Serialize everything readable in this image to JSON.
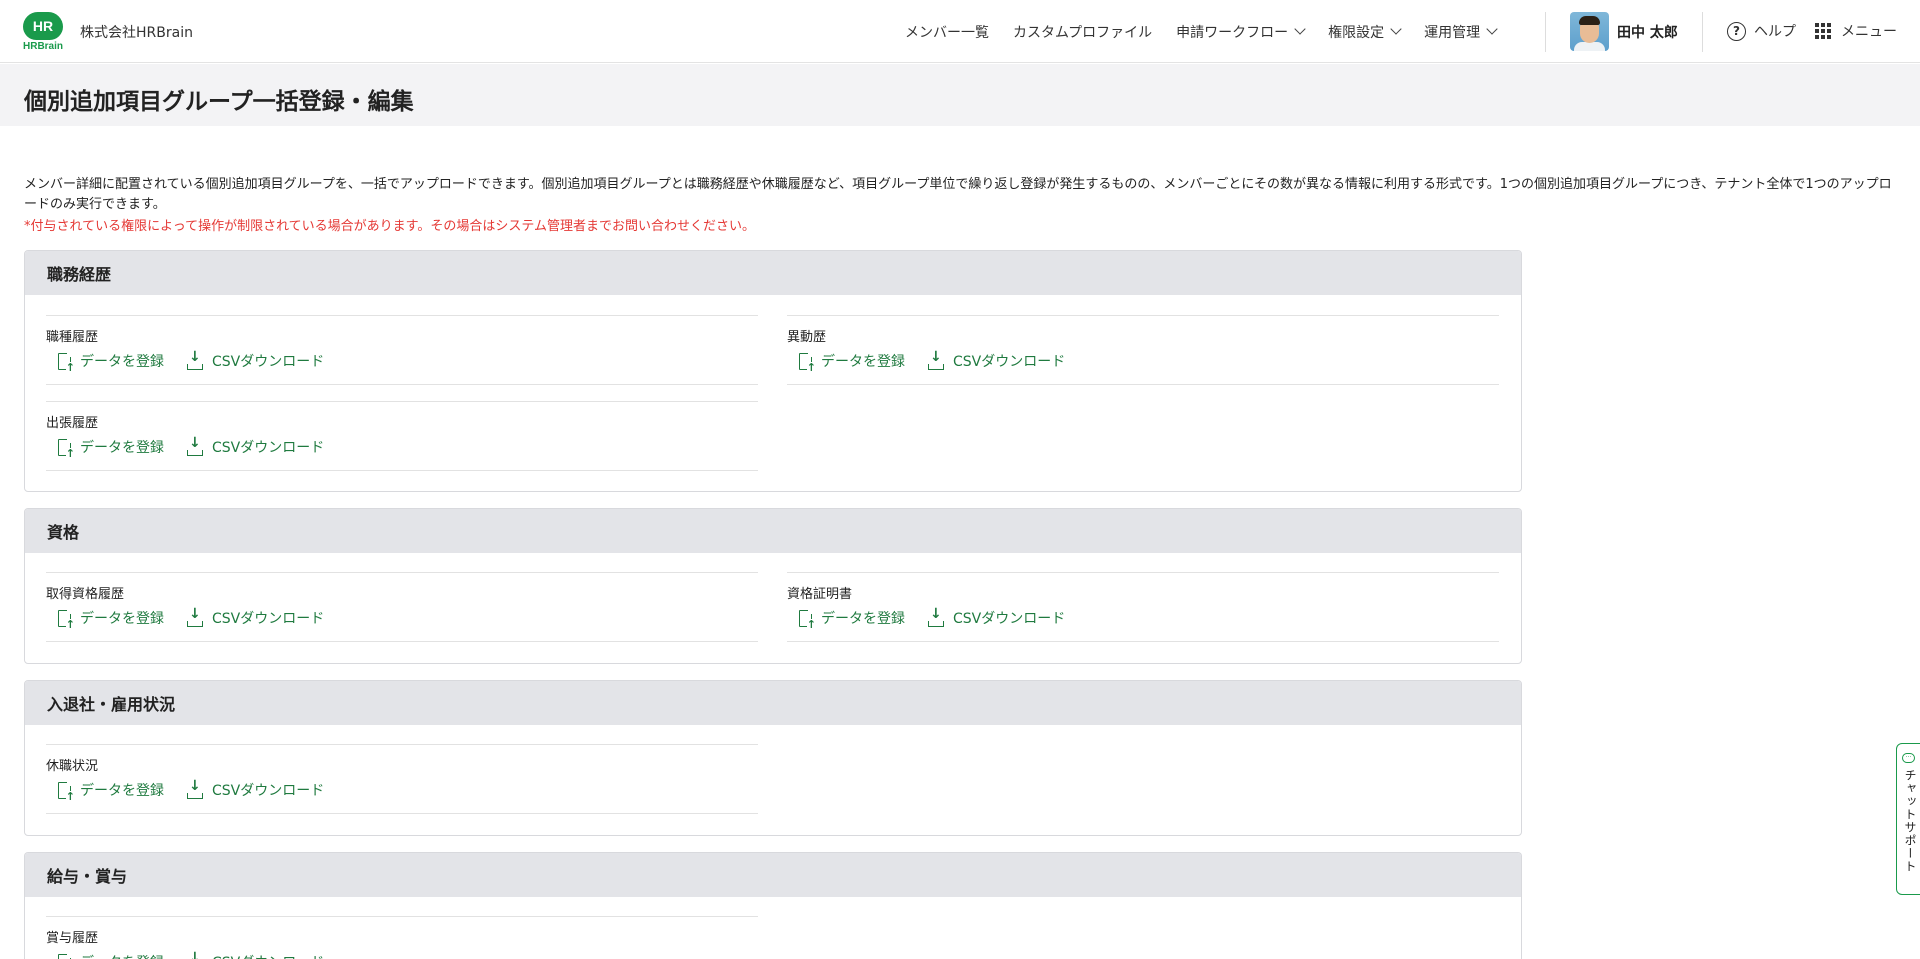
{
  "header": {
    "logo_badge": "HR",
    "logo_text": "HRBrain",
    "company": "株式会社HRBrain",
    "nav": [
      {
        "label": "メンバー一覧"
      },
      {
        "label": "カスタムプロファイル"
      },
      {
        "label": "申請ワークフロー"
      },
      {
        "label": "権限設定"
      },
      {
        "label": "運用管理"
      }
    ],
    "user_name": "田中 太郎",
    "help_label": "ヘルプ",
    "menu_label": "メニュー"
  },
  "page": {
    "title": "個別追加項目グループ一括登録・編集",
    "description": "メンバー詳細に配置されている個別追加項目グループを、一括でアップロードできます。個別追加項目グループとは職務経歴や休職履歴など、項目グループ単位で繰り返し登録が発生するものの、メンバーごとにその数が異なる情報に利用する形式です。1つの個別追加項目グループにつき、テナント全体で1つのアップロードのみ実行できます。",
    "notice": "*付与されている権限によって操作が制限されている場合があります。その場合はシステム管理者までお問い合わせください。"
  },
  "actions": {
    "register": "データを登録",
    "download": "CSVダウンロード"
  },
  "sections": [
    {
      "title": "職務経歴",
      "items": [
        "職種履歴",
        "異動歴",
        "出張履歴"
      ]
    },
    {
      "title": "資格",
      "items": [
        "取得資格履歴",
        "資格証明書"
      ]
    },
    {
      "title": "入退社・雇用状況",
      "items": [
        "休職状況"
      ]
    },
    {
      "title": "給与・賞与",
      "items": [
        "賞与履歴"
      ]
    }
  ],
  "chat": {
    "label": "チャットサポート"
  },
  "colors": {
    "brand_green": "#1a9a4b",
    "link_green": "#1f7a3f",
    "notice_red": "#e53935"
  }
}
